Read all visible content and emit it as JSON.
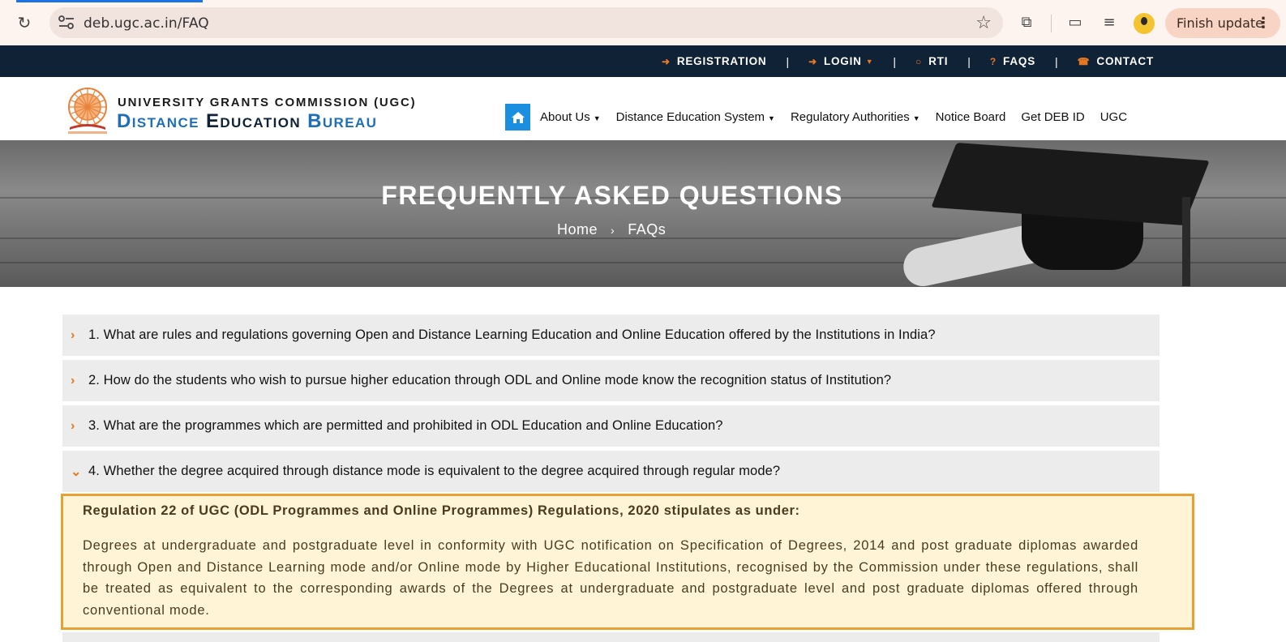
{
  "browser": {
    "url": "deb.ugc.ac.in/FAQ",
    "finish_update": "Finish update"
  },
  "topbar": {
    "items": [
      {
        "label": "REGISTRATION",
        "icon": "sign-in-icon"
      },
      {
        "label": "LOGIN",
        "icon": "sign-in-icon"
      },
      {
        "label": "RTI",
        "icon": "chat-icon"
      },
      {
        "label": "FAQS",
        "icon": "question-icon"
      },
      {
        "label": "CONTACT",
        "icon": "phone-icon"
      }
    ],
    "accent_color": "#e87722",
    "background": "#0f2236"
  },
  "header": {
    "org_name": "UNIVERSITY GRANTS COMMISSION (UGC)",
    "bureau": {
      "w1": "Distance",
      "w2": "Education",
      "w3": "Bureau"
    },
    "nav": [
      {
        "label": "About Us",
        "dropdown": true
      },
      {
        "label": "Distance Education System",
        "dropdown": true
      },
      {
        "label": "Regulatory Authorities",
        "dropdown": true
      },
      {
        "label": "Notice Board",
        "dropdown": false
      },
      {
        "label": "Get DEB ID",
        "dropdown": false
      },
      {
        "label": "UGC",
        "dropdown": false
      }
    ]
  },
  "banner": {
    "title": "FREQUENTLY ASKED QUESTIONS",
    "breadcrumb_home": "Home",
    "breadcrumb_sep": "›",
    "breadcrumb_current": "FAQs"
  },
  "faqs": [
    {
      "question": "1. What are rules and regulations governing Open and Distance Learning Education and Online Education offered by the Institutions in India?",
      "expanded": false
    },
    {
      "question": "2. How do the students who wish to pursue higher education through ODL and Online mode know the recognition status of Institution?",
      "expanded": false
    },
    {
      "question": "3. What are the programmes which are permitted and prohibited in ODL Education and Online Education?",
      "expanded": false
    },
    {
      "question": "4. Whether the degree acquired through distance mode is equivalent to the degree acquired through regular mode?",
      "expanded": true
    }
  ],
  "answer": {
    "heading": "Regulation 22 of UGC (ODL Programmes and Online Programmes) Regulations, 2020 stipulates as under:",
    "body": "Degrees at undergraduate and postgraduate level in conformity with UGC notification on Specification of Degrees, 2014 and post graduate diplomas awarded through Open and Distance Learning mode and/or Online mode by Higher Educational Institutions, recognised by the Commission under these regulations, shall be treated as equivalent to the corresponding awards of the Degrees at undergraduate and postgraduate level and post graduate diplomas offered through conventional mode."
  }
}
